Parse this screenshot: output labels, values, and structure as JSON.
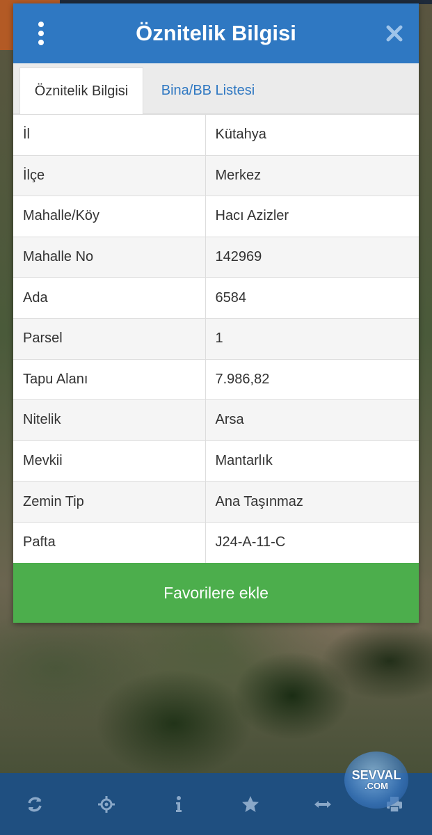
{
  "dialog": {
    "title": "Öznitelik Bilgisi",
    "tabs": [
      {
        "label": "Öznitelik Bilgisi",
        "active": true
      },
      {
        "label": "Bina/BB Listesi",
        "active": false
      }
    ],
    "rows": [
      {
        "key": "İl",
        "value": "Kütahya"
      },
      {
        "key": "İlçe",
        "value": "Merkez"
      },
      {
        "key": "Mahalle/Köy",
        "value": "Hacı Azizler"
      },
      {
        "key": "Mahalle No",
        "value": "142969"
      },
      {
        "key": "Ada",
        "value": "6584"
      },
      {
        "key": "Parsel",
        "value": "1"
      },
      {
        "key": "Tapu Alanı",
        "value": "7.986,82"
      },
      {
        "key": "Nitelik",
        "value": "Arsa"
      },
      {
        "key": "Mevkii",
        "value": "Mantarlık"
      },
      {
        "key": "Zemin Tip",
        "value": "Ana Taşınmaz"
      },
      {
        "key": "Pafta",
        "value": "J24-A-11-C"
      }
    ],
    "favorite_button": "Favorilere ekle"
  },
  "toolbar": {
    "icons": [
      "refresh-icon",
      "locate-icon",
      "info-icon",
      "star-icon",
      "measure-icon",
      "print-icon"
    ]
  },
  "watermark": {
    "text": "SEVVAL",
    "sub": ".COM"
  },
  "colors": {
    "header": "#2f78c2",
    "favorite": "#4cae4c",
    "toolbar": "#1f4f80",
    "tab_link": "#2f78c2"
  }
}
